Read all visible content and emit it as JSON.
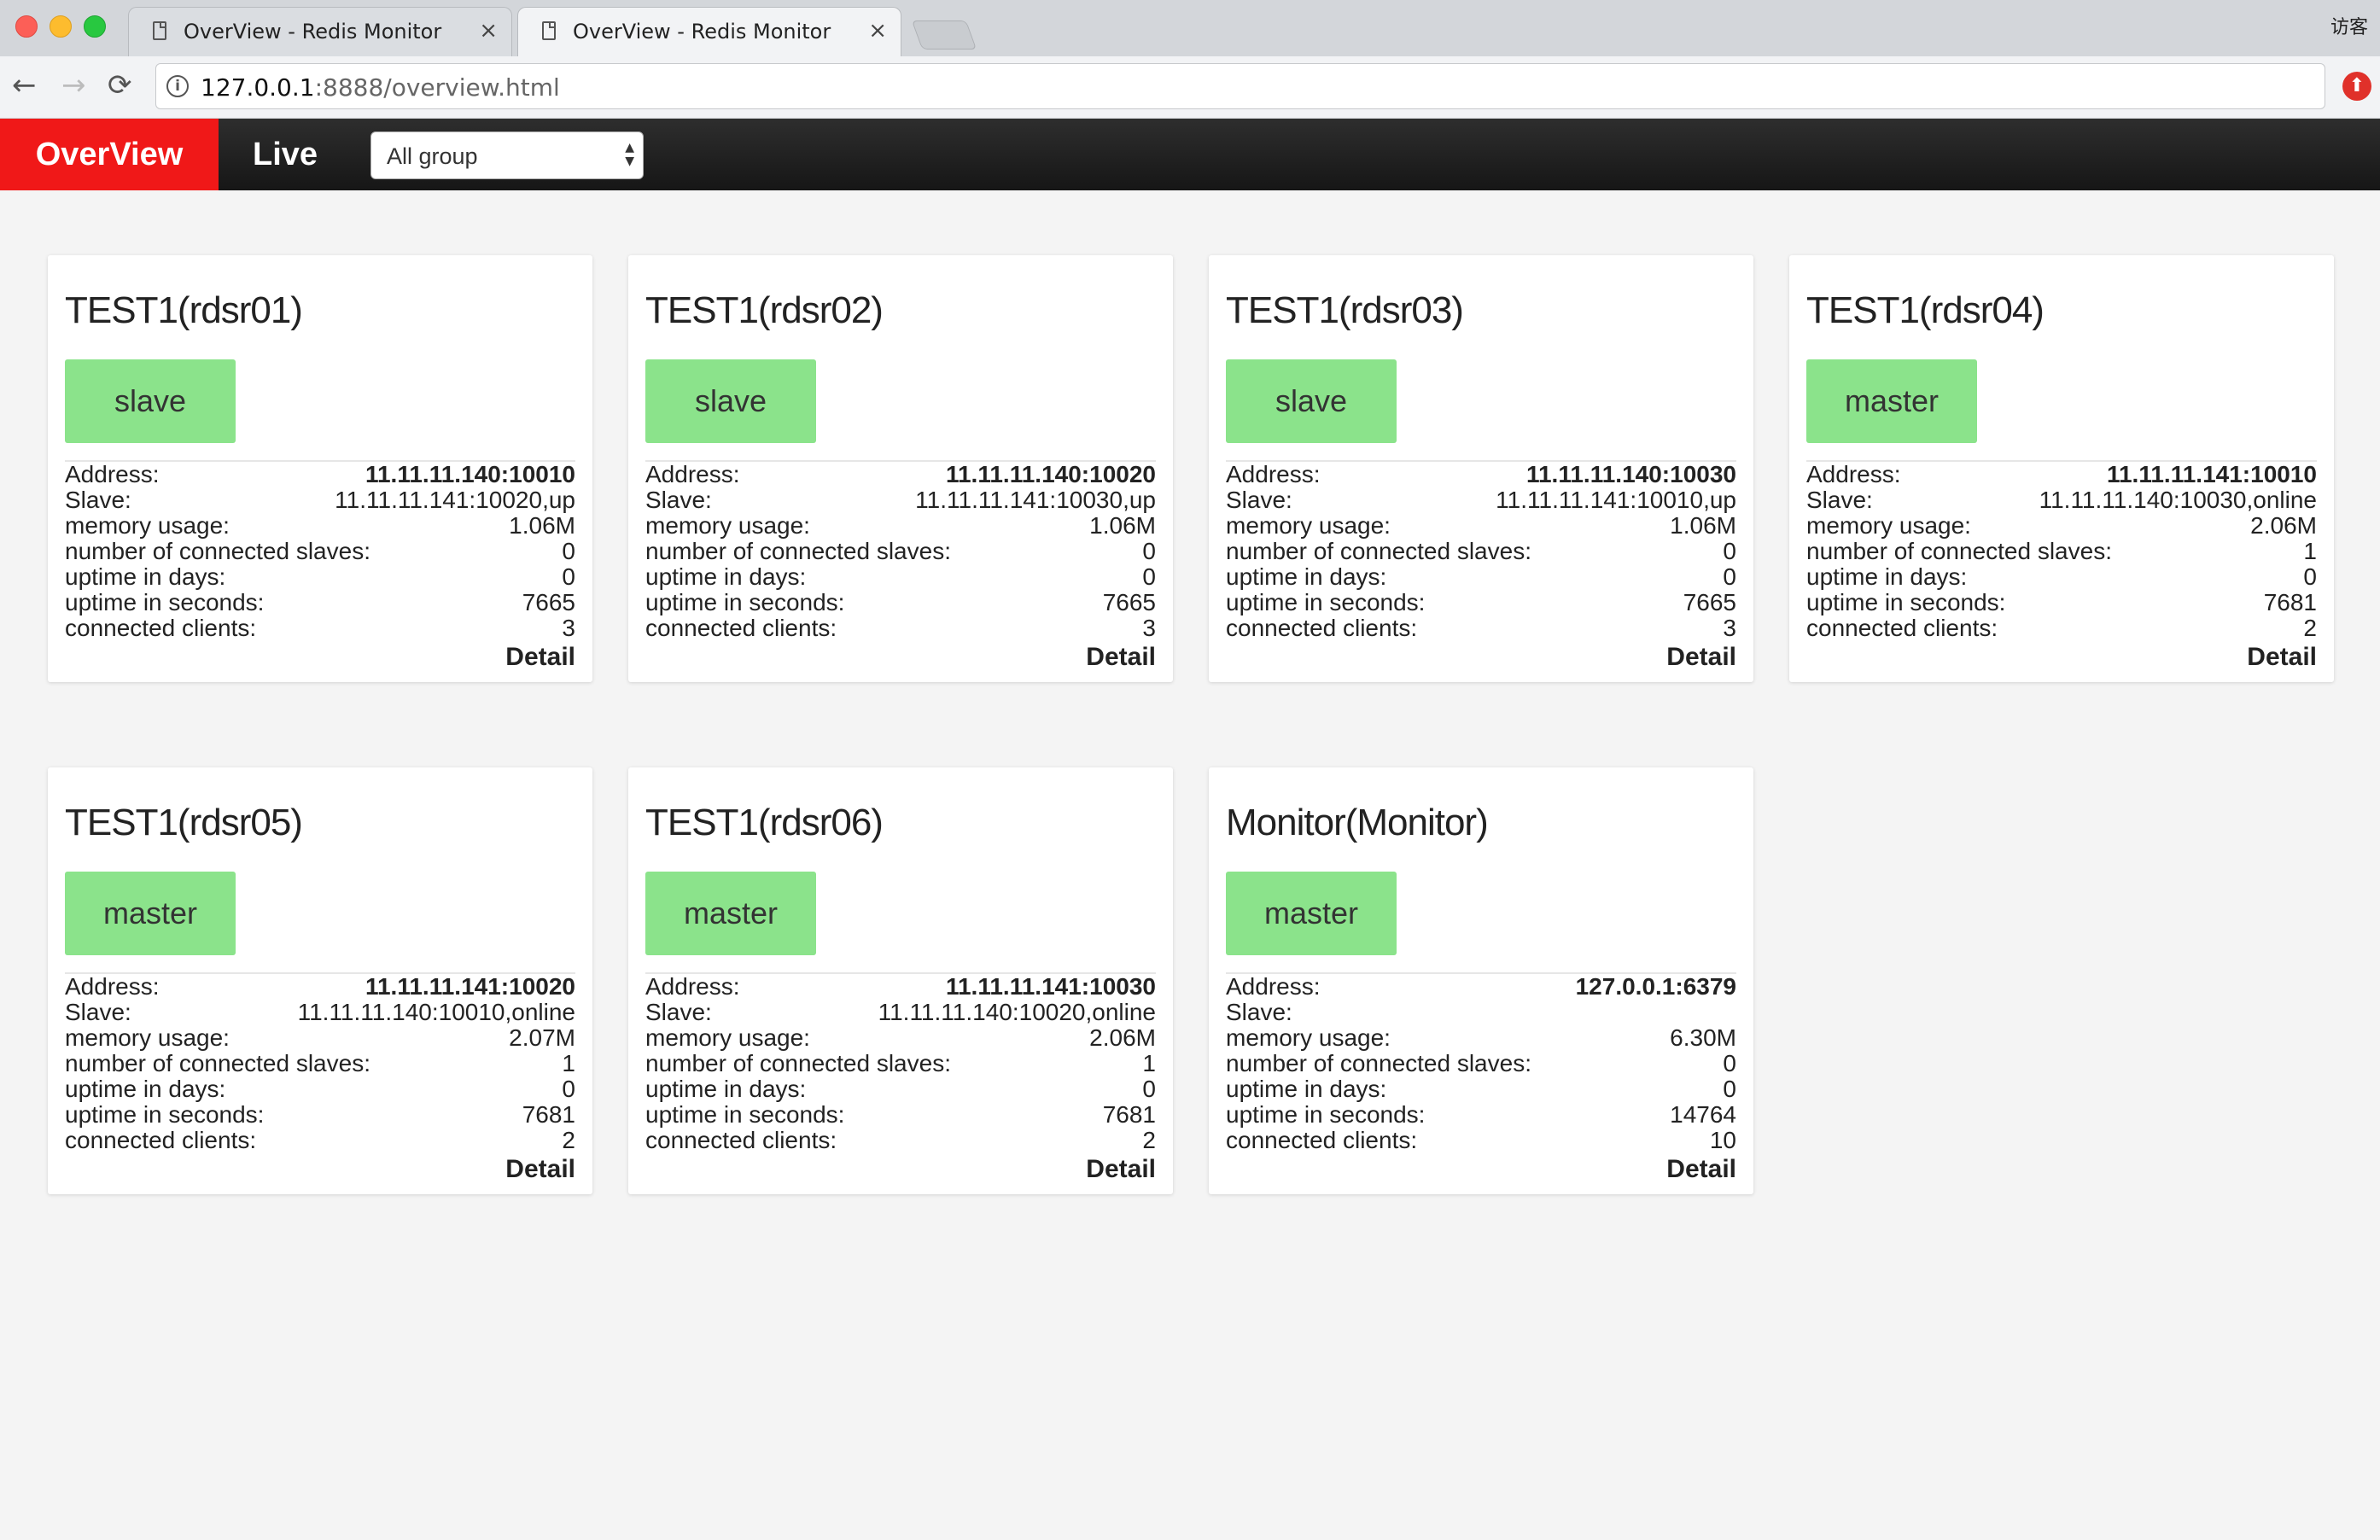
{
  "browser": {
    "tabs": [
      {
        "title": "OverView - Redis Monitor",
        "close": "×"
      },
      {
        "title": "OverView - Redis Monitor",
        "close": "×"
      }
    ],
    "guest_label": "访客",
    "nav": {
      "back": "←",
      "forward": "→",
      "reload": "⟳"
    },
    "url_host": "127.0.0.1",
    "url_rest": ":8888/overview.html"
  },
  "app": {
    "nav_overview": "OverView",
    "nav_live": "Live",
    "group_select": {
      "value": "All group",
      "arrows": "▲▼"
    }
  },
  "labels": {
    "address": "Address:",
    "slave": "Slave:",
    "memory": "memory usage:",
    "slaves_count": "number of connected slaves:",
    "uptime_days": "uptime in days:",
    "uptime_seconds": "uptime in seconds:",
    "clients": "connected clients:",
    "detail": "Detail"
  },
  "cards": [
    {
      "title": "TEST1(rdsr01)",
      "role": "slave",
      "address": "11.11.11.140:10010",
      "slave": "11.11.11.141:10020,up",
      "memory": "1.06M",
      "slaves_count": "0",
      "uptime_days": "0",
      "uptime_seconds": "7665",
      "clients": "3"
    },
    {
      "title": "TEST1(rdsr02)",
      "role": "slave",
      "address": "11.11.11.140:10020",
      "slave": "11.11.11.141:10030,up",
      "memory": "1.06M",
      "slaves_count": "0",
      "uptime_days": "0",
      "uptime_seconds": "7665",
      "clients": "3"
    },
    {
      "title": "TEST1(rdsr03)",
      "role": "slave",
      "address": "11.11.11.140:10030",
      "slave": "11.11.11.141:10010,up",
      "memory": "1.06M",
      "slaves_count": "0",
      "uptime_days": "0",
      "uptime_seconds": "7665",
      "clients": "3"
    },
    {
      "title": "TEST1(rdsr04)",
      "role": "master",
      "address": "11.11.11.141:10010",
      "slave": "11.11.11.140:10030,online",
      "memory": "2.06M",
      "slaves_count": "1",
      "uptime_days": "0",
      "uptime_seconds": "7681",
      "clients": "2"
    },
    {
      "title": "TEST1(rdsr05)",
      "role": "master",
      "address": "11.11.11.141:10020",
      "slave": "11.11.11.140:10010,online",
      "memory": "2.07M",
      "slaves_count": "1",
      "uptime_days": "0",
      "uptime_seconds": "7681",
      "clients": "2"
    },
    {
      "title": "TEST1(rdsr06)",
      "role": "master",
      "address": "11.11.11.141:10030",
      "slave": "11.11.11.140:10020,online",
      "memory": "2.06M",
      "slaves_count": "1",
      "uptime_days": "0",
      "uptime_seconds": "7681",
      "clients": "2"
    },
    {
      "title": "Monitor(Monitor)",
      "role": "master",
      "address": "127.0.0.1:6379",
      "slave": "",
      "memory": "6.30M",
      "slaves_count": "0",
      "uptime_days": "0",
      "uptime_seconds": "14764",
      "clients": "10"
    }
  ],
  "colors": {
    "accent": "#f01818",
    "role_badge": "#8be38b",
    "nav_bg": "#1e1e1e"
  }
}
